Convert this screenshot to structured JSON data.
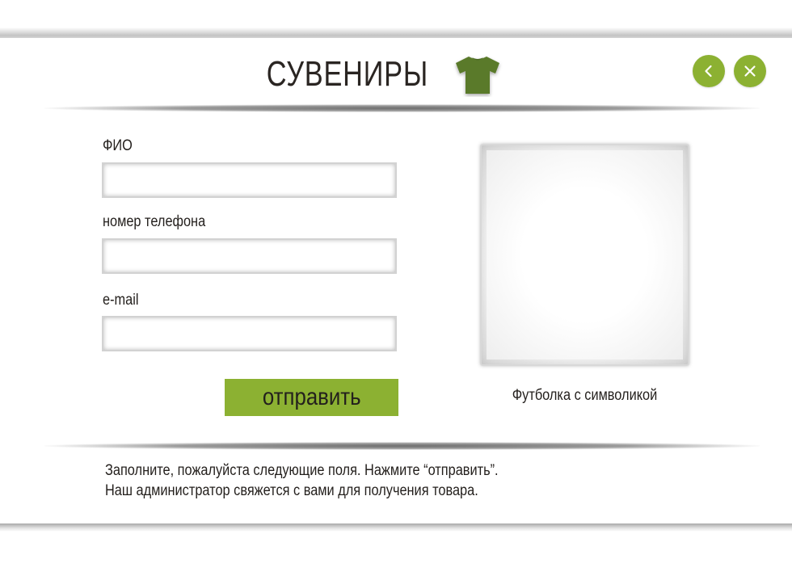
{
  "header": {
    "title": "СУВЕНИРЫ",
    "shirt_icon": "t-shirt-icon",
    "back_icon": "chevron-left-icon",
    "close_icon": "close-icon"
  },
  "form": {
    "name_label": "ФИО",
    "name_value": "",
    "phone_label": "номер телефона",
    "phone_value": "",
    "email_label": "e-mail",
    "email_value": "",
    "submit_label": "отправить"
  },
  "product": {
    "caption": "Футболка с символикой"
  },
  "footer": {
    "line1": "Заполните, пожалуйста следующие поля. Нажмите “отправить”.",
    "line2": "Наш администратор свяжется с вами для получения товара."
  },
  "colors": {
    "accent": "#8cb132",
    "shirt": "#5a7a2b",
    "text": "#231f1c"
  }
}
